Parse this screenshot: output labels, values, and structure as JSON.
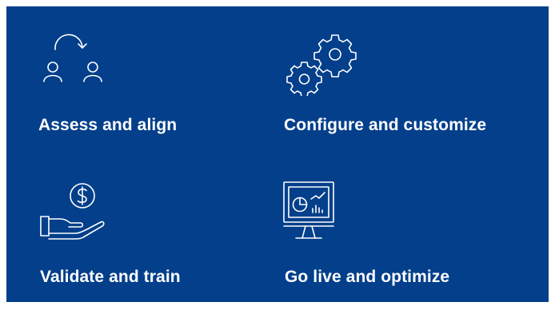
{
  "panel": {
    "background_color": "#033f8b",
    "text_color": "#ffffff"
  },
  "steps": [
    {
      "label": "Assess and align",
      "icon": "two-people-cycle-icon"
    },
    {
      "label": "Configure and customize",
      "icon": "gears-icon"
    },
    {
      "label": "Validate and train",
      "icon": "hand-coin-icon"
    },
    {
      "label": "Go live and optimize",
      "icon": "monitor-analytics-icon"
    }
  ]
}
